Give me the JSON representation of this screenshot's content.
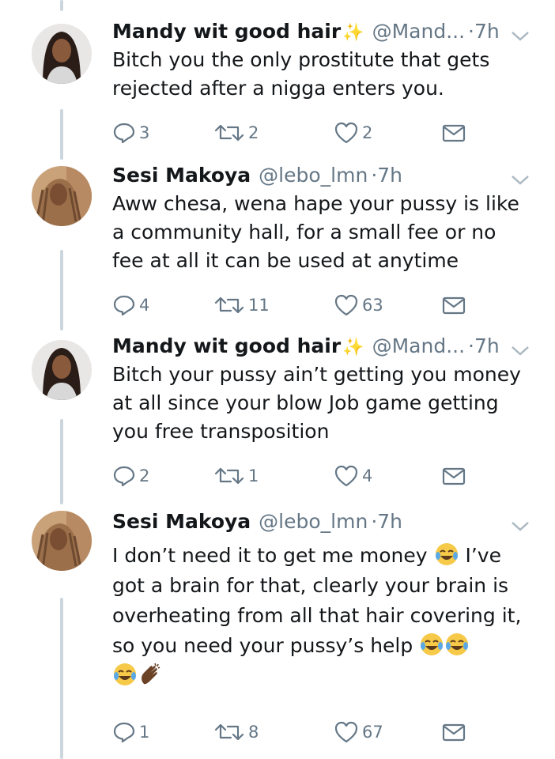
{
  "tweets": [
    {
      "name": "Mandy wit good hair",
      "name_emoji": "✨",
      "handle": "@Mand...",
      "dot": "·",
      "time": "7h",
      "text": "Bitch you the only prostitute that gets rejected after a nigga enters you.",
      "replies": "3",
      "retweets": "2",
      "likes": "2"
    },
    {
      "name": "Sesi Makoya",
      "name_emoji": "",
      "handle": "@lebo_lmn",
      "dot": "·",
      "time": "7h",
      "text": "Aww chesa, wena hape your pussy is like a community hall, for a small fee or no fee at all it can be used at anytime",
      "replies": "4",
      "retweets": "11",
      "likes": "63"
    },
    {
      "name": "Mandy wit good hair",
      "name_emoji": "✨",
      "handle": "@Mand...",
      "dot": "·",
      "time": "7h",
      "text": "Bitch your pussy ain’t getting you money at all since your blow Job game getting you free transposition",
      "replies": "2",
      "retweets": "1",
      "likes": "4"
    },
    {
      "name": "Sesi Makoya",
      "name_emoji": "",
      "handle": "@lebo_lmn",
      "dot": "·",
      "time": "7h",
      "text_part1": "I don’t need it to get me money",
      "text_part2": "I’ve got a brain for that, clearly your brain is overheating from all that hair covering it, so you need your pussy’s help",
      "emojis": [
        "joy-emoji",
        "joy-emoji",
        "joy-emoji",
        "joy-emoji",
        "clap-emoji"
      ],
      "replies": "1",
      "retweets": "8",
      "likes": "67"
    }
  ],
  "icons": {
    "reply": "reply-icon",
    "retweet": "retweet-icon",
    "like": "heart-icon",
    "dm": "envelope-icon",
    "more": "chevron-down-icon"
  },
  "colors": {
    "text": "#14171a",
    "secondary": "#657786",
    "thread_line": "#ccd6dd"
  }
}
